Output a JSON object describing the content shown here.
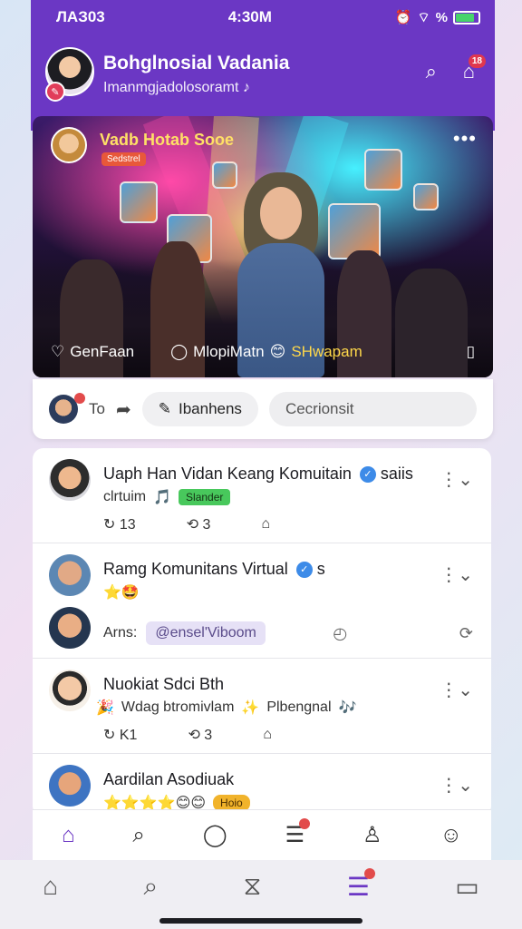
{
  "status_bar": {
    "carrier": "ЛАЗ03",
    "time": "4:30M",
    "battery_percent": "%"
  },
  "header": {
    "title": "Bohglnosial Vadania",
    "subtitle": "Imanmgjadolosoramt",
    "notification_count": "18"
  },
  "hero": {
    "title": "Vadb Hotab Sooe",
    "tag": "Sedstrel",
    "more_label": "•••",
    "actions": {
      "like_label": "GenFaan",
      "comment_label": "MlopiMatn",
      "emoji_label": "SHwapam"
    }
  },
  "composer": {
    "to_label": "To",
    "share_label": "Ibanhens",
    "field_text": "Cecrionsit"
  },
  "feed": {
    "posts": [
      {
        "name": "Uaph Han Vidan Keang Komuitain",
        "name_suffix": "saiis",
        "line2_text": "clrtuim",
        "badge": "Slander",
        "likes": "13",
        "shares": "3"
      },
      {
        "name": "Ramg Komunitans Virtual",
        "name_suffix": "s",
        "emojis": "⭐🤩",
        "mention_label": "Arns:",
        "mention_chip": "@ensel'Viboom"
      },
      {
        "name": "Nuokiat Sdci Bth",
        "line2_text": "Wdag btromivlam",
        "line2_suffix": "Plbengnal",
        "likes": "K1",
        "shares": "3"
      },
      {
        "name": "Aardilan Asodiuak",
        "badge": "Hoio"
      }
    ]
  },
  "colors": {
    "brand": "#6b37c4",
    "verified": "#3d8be8",
    "badge_green": "#48c85c",
    "badge_gold": "#f1b32b",
    "alert": "#e24b4b"
  }
}
